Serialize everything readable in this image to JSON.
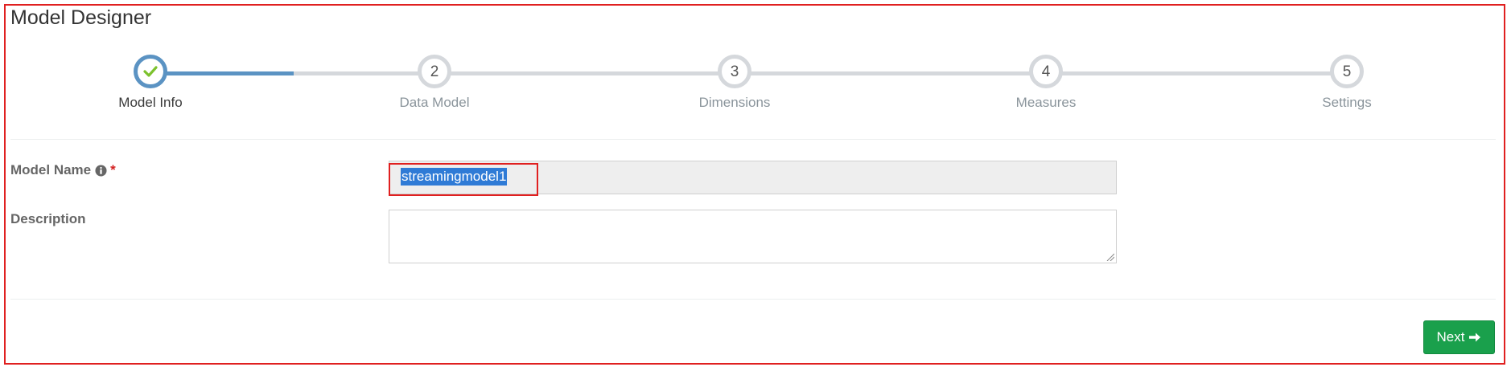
{
  "page": {
    "title": "Model Designer"
  },
  "wizard": {
    "steps": [
      {
        "number": "1",
        "label": "Model Info",
        "state": "completed",
        "icon": "check-icon"
      },
      {
        "number": "2",
        "label": "Data Model",
        "state": "pending"
      },
      {
        "number": "3",
        "label": "Dimensions",
        "state": "pending"
      },
      {
        "number": "4",
        "label": "Measures",
        "state": "pending"
      },
      {
        "number": "5",
        "label": "Settings",
        "state": "pending"
      }
    ],
    "progress_color": "#5b93c3",
    "track_color": "#d5d8dc",
    "check_color": "#7cc22d"
  },
  "form": {
    "model_name": {
      "label": "Model Name",
      "required_mark": "*",
      "info_icon": "info-circle-icon",
      "value": "streamingmodel1"
    },
    "description": {
      "label": "Description",
      "value": ""
    }
  },
  "actions": {
    "next_label": "Next",
    "next_icon": "arrow-right-icon",
    "next_color": "#1aa04c"
  }
}
